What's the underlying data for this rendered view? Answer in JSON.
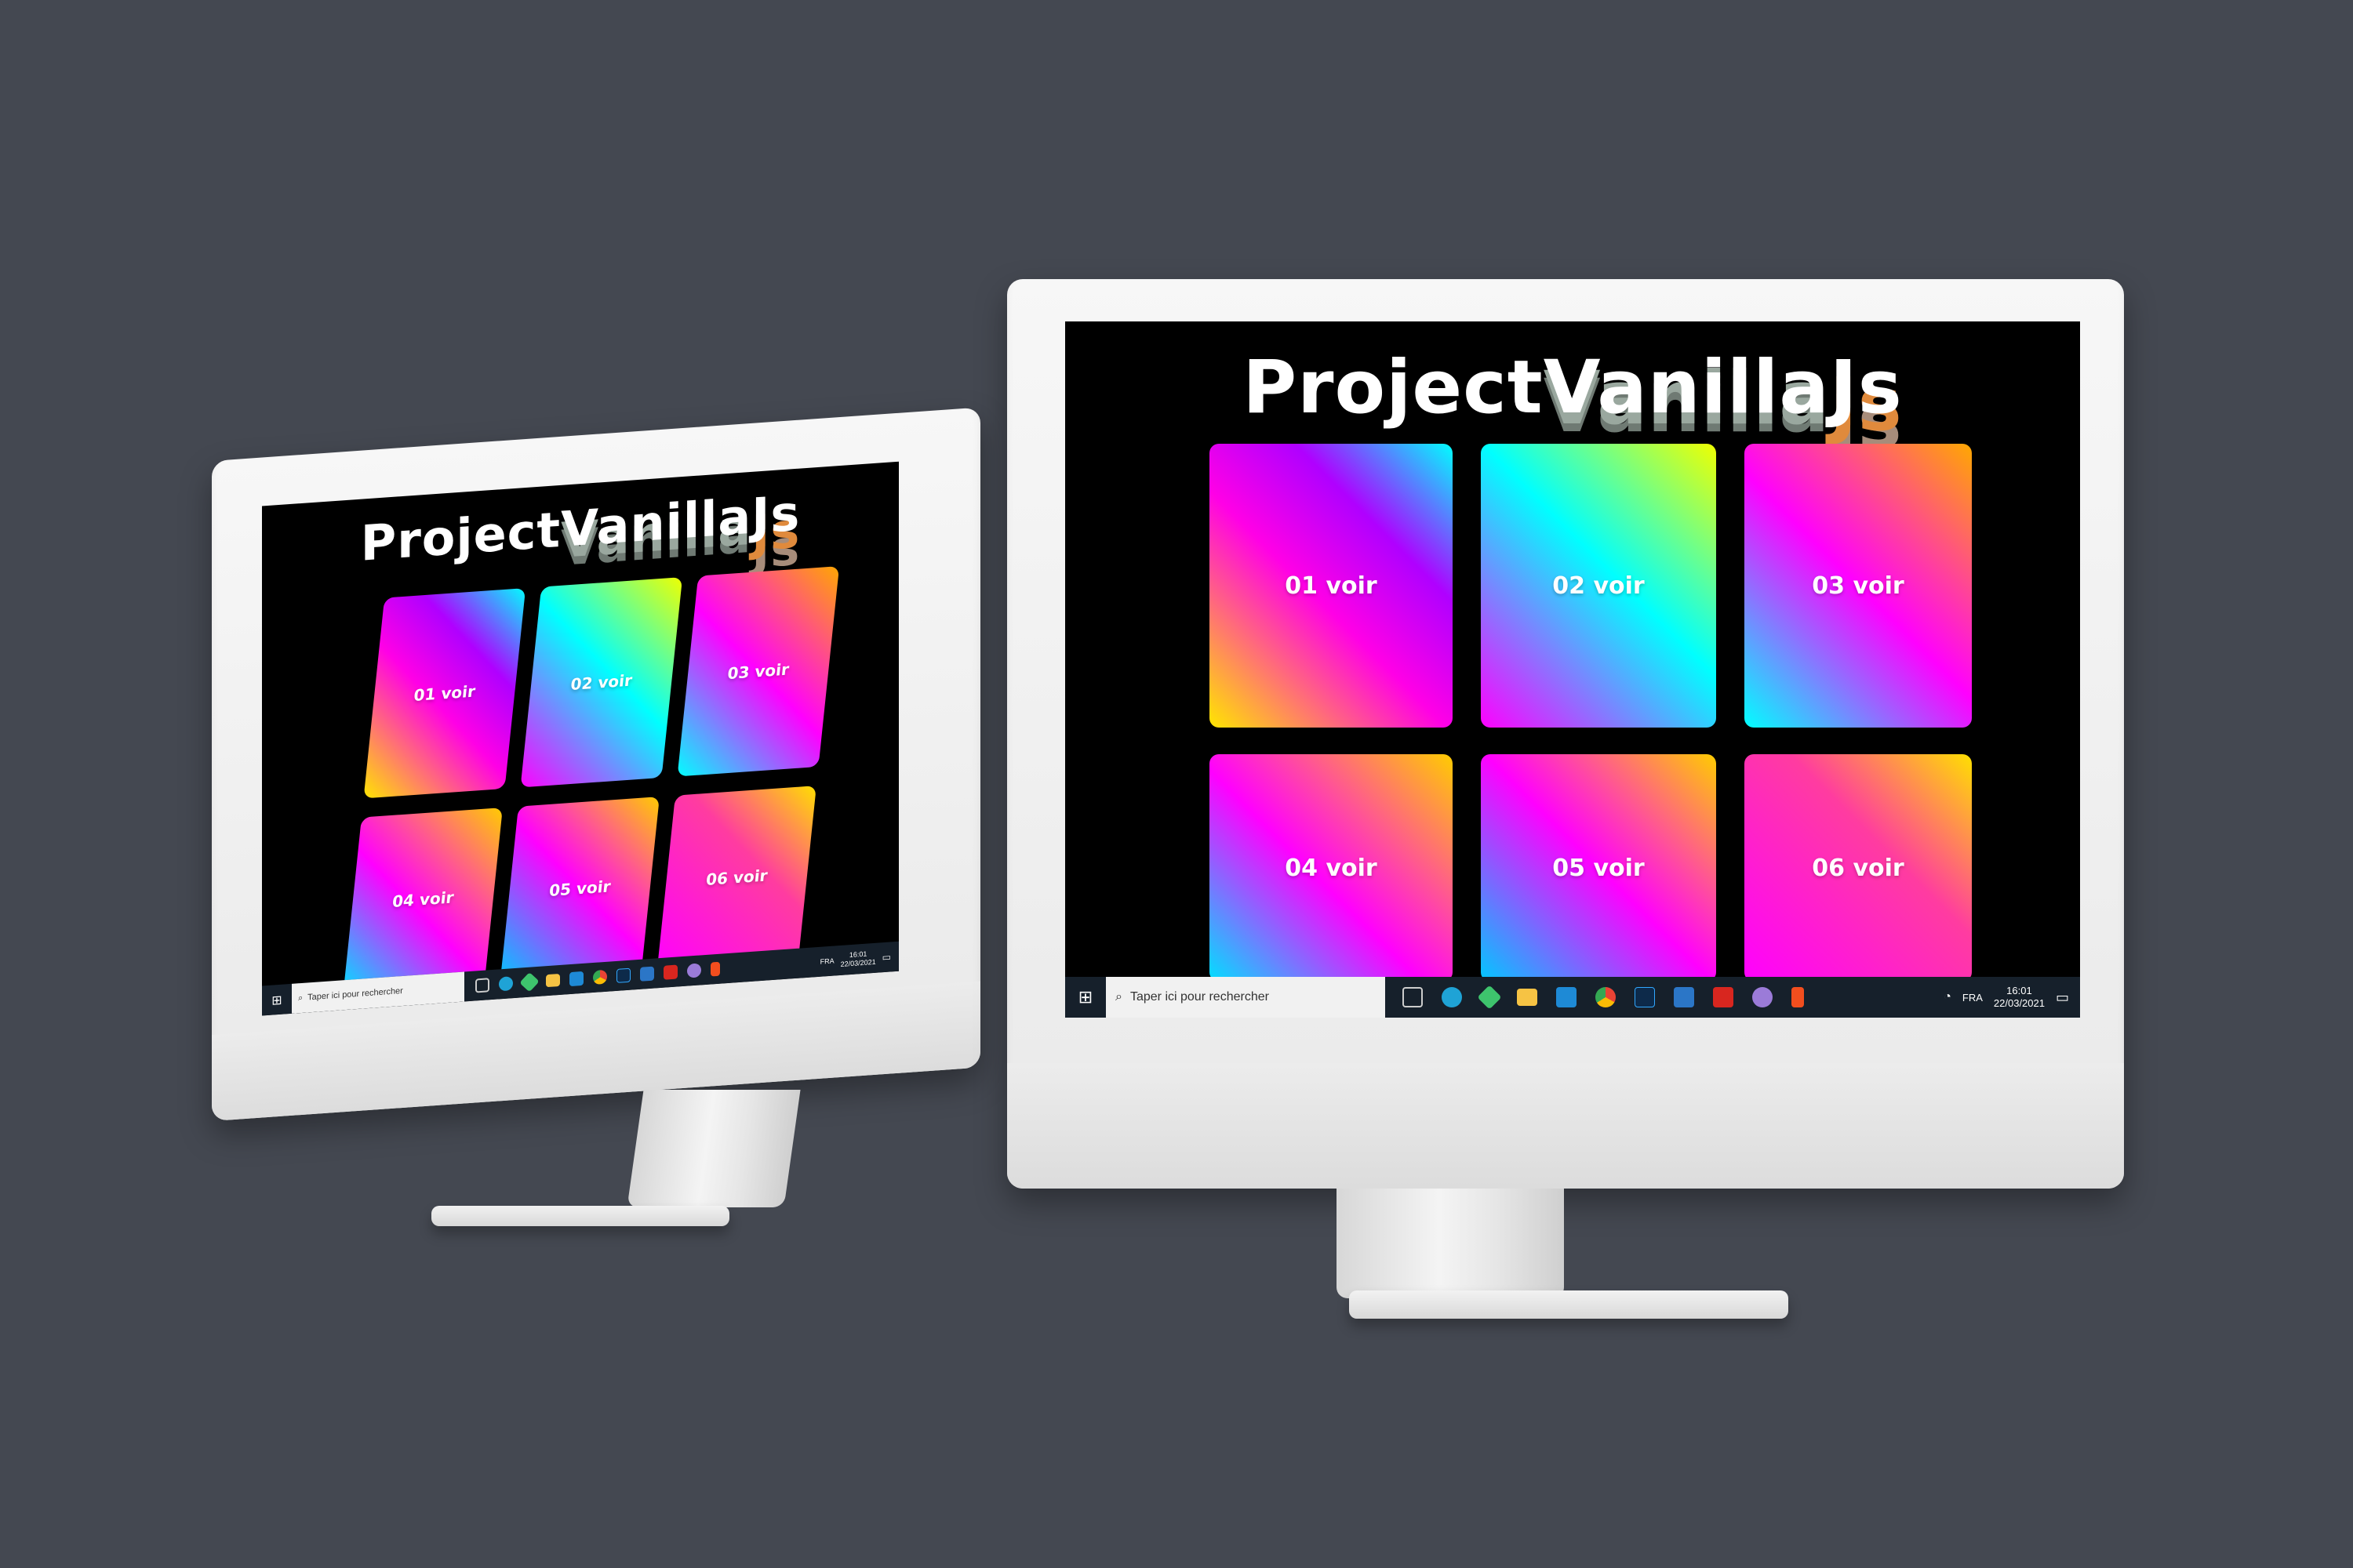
{
  "page": {
    "title_words": [
      "Project",
      "Vanilla",
      "Js"
    ]
  },
  "cards": [
    {
      "label": "01 voir"
    },
    {
      "label": "02 voir"
    },
    {
      "label": "03 voir"
    },
    {
      "label": "04 voir"
    },
    {
      "label": "05 voir"
    },
    {
      "label": "06 voir"
    }
  ],
  "taskbar": {
    "search_placeholder": "Taper ici pour rechercher",
    "language": "FRA",
    "time": "16:01",
    "date": "22/03/2021",
    "apps": [
      "task-view-icon",
      "edge-icon",
      "git-icon",
      "folder-icon",
      "vscode-icon",
      "chrome-icon",
      "photoshop-icon",
      "photos-icon",
      "acrobat-icon",
      "github-icon",
      "figma-icon"
    ]
  },
  "colors": {
    "background": "#444851",
    "screen": "#000000",
    "taskbar": "#16202b",
    "bezel": "#f0f0f0"
  }
}
